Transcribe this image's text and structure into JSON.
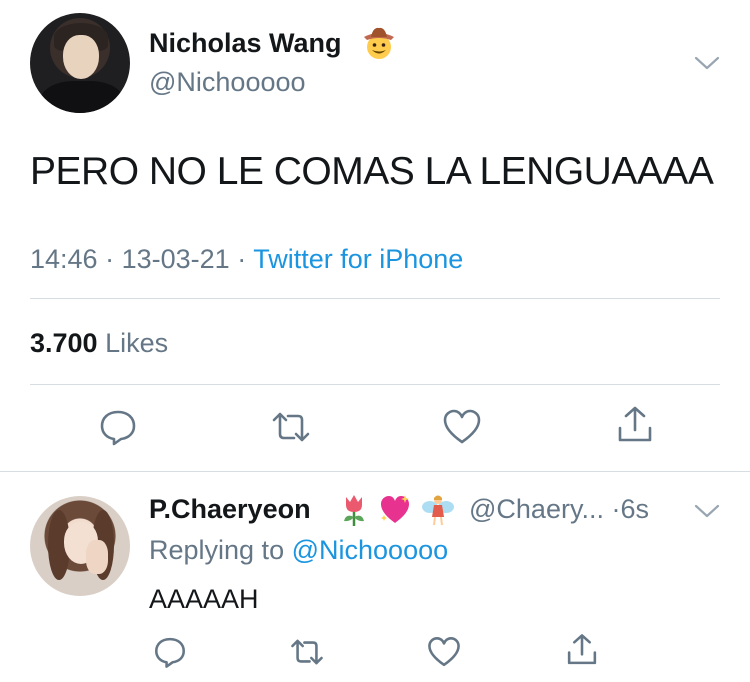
{
  "tweet": {
    "author": {
      "display_name": "Nicholas Wang",
      "name_emoji": "cowboy-face-emoji",
      "handle": "@Nichooooo"
    },
    "text": "PERO NO LE COMAS LA LENGUAAAA",
    "time": "14:46",
    "date": "13-03-21",
    "source": "Twitter for iPhone",
    "separator": "·",
    "likes_count": "3.700",
    "likes_label": "Likes",
    "actions": [
      "reply-icon",
      "retweet-icon",
      "like-icon",
      "share-icon"
    ]
  },
  "reply": {
    "display_name": "P.Chaeryeon",
    "name_emojis": [
      "tulip-emoji",
      "sparkling-heart-emoji",
      "fairy-emoji"
    ],
    "handle": "@Chaery...",
    "age": "6s",
    "replying_label": "Replying to",
    "replying_to": "@Nichooooo",
    "text": "AAAAAH",
    "actions": [
      "reply-icon",
      "retweet-icon",
      "like-icon",
      "share-icon"
    ]
  },
  "colors": {
    "text_primary": "#14171a",
    "text_secondary": "#657786",
    "link": "#1b95e0",
    "divider": "#d6dde3",
    "icon": "#657786"
  }
}
